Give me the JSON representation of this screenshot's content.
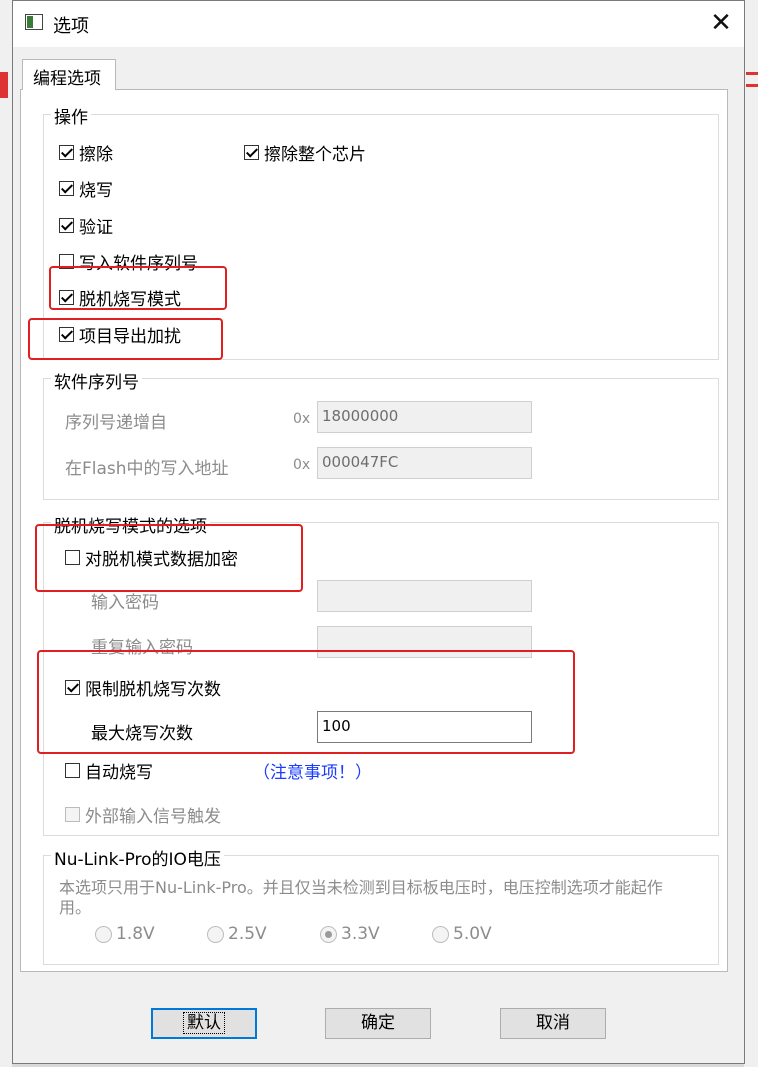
{
  "window": {
    "title": "选项"
  },
  "tab": {
    "label": "编程选项"
  },
  "operations": {
    "legend": "操作",
    "erase": {
      "label": "擦除",
      "checked": true
    },
    "erase_chip": {
      "label": "擦除整个芯片",
      "checked": true
    },
    "program": {
      "label": "烧写",
      "checked": true
    },
    "verify": {
      "label": "验证",
      "checked": true
    },
    "write_serial": {
      "label": "写入软件序列号",
      "checked": false
    },
    "offline_mode": {
      "label": "脱机烧写模式",
      "checked": true
    },
    "project_export_encrypt": {
      "label": "项目导出加扰",
      "checked": true
    }
  },
  "serial": {
    "legend": "软件序列号",
    "increment_label": "序列号递增自",
    "increment_prefix": "0x",
    "increment_value": "18000000",
    "address_label": "在Flash中的写入地址",
    "address_prefix": "0x",
    "address_value": "000047FC"
  },
  "offline": {
    "legend": "脱机烧写模式的选项",
    "encrypt": {
      "label": "对脱机模式数据加密",
      "checked": false
    },
    "password_label": "输入密码",
    "password_value": "",
    "repeat_password_label": "重复输入密码",
    "repeat_password_value": "",
    "limit_count": {
      "label": "限制脱机烧写次数",
      "checked": true
    },
    "max_count_label": "最大烧写次数",
    "max_count_value": "100",
    "auto_program": {
      "label": "自动烧写",
      "checked": false
    },
    "note_link": "（注意事项！）",
    "external_trigger": {
      "label": "外部输入信号触发",
      "checked": false
    }
  },
  "voltage": {
    "legend": "Nu-Link-Pro的IO电压",
    "description": "本选项只用于Nu-Link-Pro。并且仅当未检测到目标板电压时，电压控制选项才能起作用。",
    "options": [
      "1.8V",
      "2.5V",
      "3.3V",
      "5.0V"
    ],
    "selected": "3.3V"
  },
  "buttons": {
    "default": "默认",
    "ok": "确定",
    "cancel": "取消"
  },
  "colors": {
    "highlight": "#e02020",
    "link": "#1a3cff",
    "default_button_border": "#0078d7"
  }
}
